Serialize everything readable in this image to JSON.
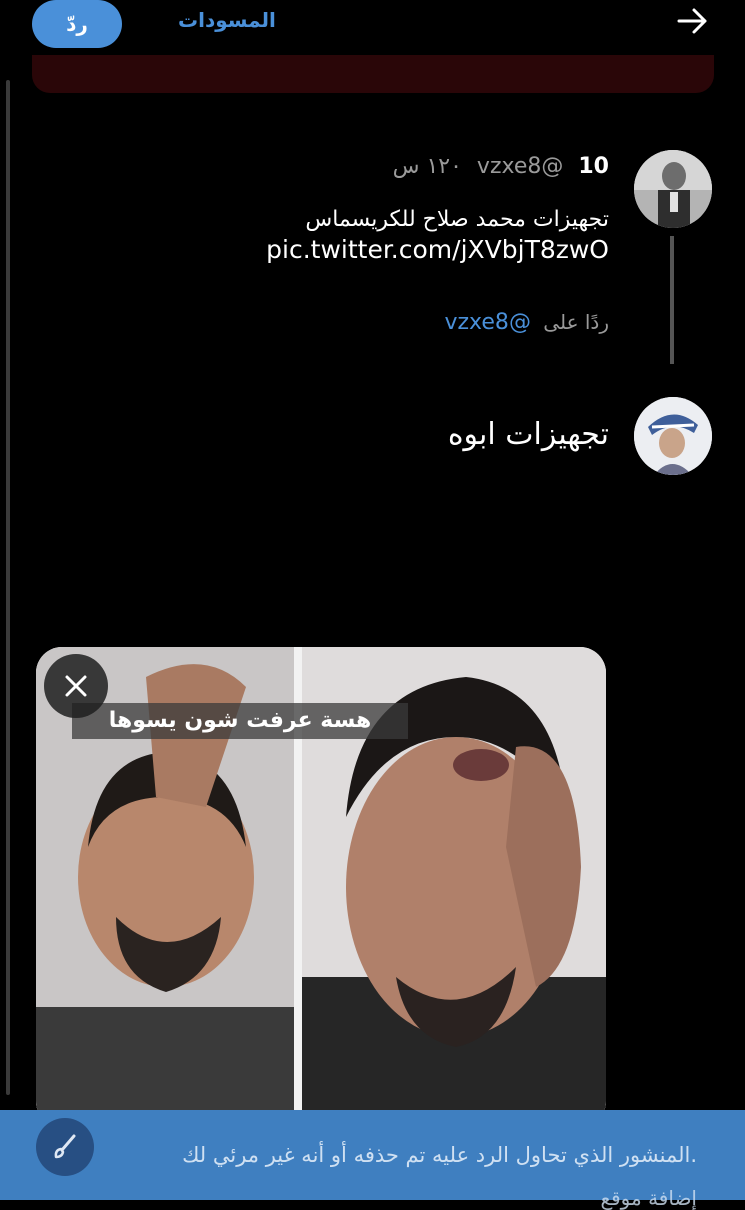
{
  "header": {
    "reply_label": "ردّ",
    "drafts_label": "المسودات"
  },
  "parent_tweet": {
    "display_name": "10",
    "handle": "@vzxe8",
    "time": "١٢٠ س",
    "text_line1": "تجهيزات محمد صلاح للكريسماس",
    "link": "pic.twitter.com/jXVbjT8zwO"
  },
  "replying_to": {
    "prefix": "ردًا على",
    "mention": "@vzxe8"
  },
  "reply": {
    "text": "تجهيزات ابوه"
  },
  "media": {
    "caption": "هسة عرفت شون يسوها"
  },
  "notice": {
    "text": ".المنشور الذي تحاول الرد عليه تم حذفه أو أنه غير مرئي لك",
    "second_line_partial": "إضافة موقع"
  },
  "colors": {
    "accent": "#4a90d9",
    "background": "#000000",
    "notice": "#3f7fc0"
  }
}
